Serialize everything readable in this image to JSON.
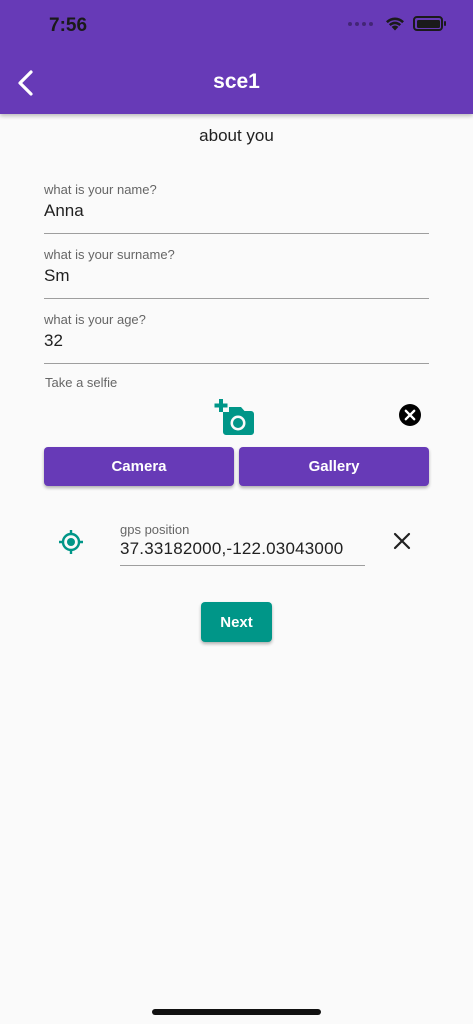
{
  "status_bar": {
    "time": "7:56"
  },
  "app_bar": {
    "title": "sce1",
    "back_icon": "chevron-left-icon"
  },
  "form": {
    "section_title": "about you",
    "name": {
      "label": "what is your name?",
      "value": "Anna"
    },
    "surname": {
      "label": "what is your surname?",
      "value": "Sm"
    },
    "age": {
      "label": "what is your age?",
      "value": "32"
    },
    "selfie": {
      "label": "Take a selfie",
      "add_icon": "add-a-photo-icon",
      "clear_icon": "cancel-circle-icon"
    },
    "camera_label": "Camera",
    "gallery_label": "Gallery",
    "gps": {
      "label": "gps position",
      "value": "37.33182000,-122.03043000",
      "icon": "my-location-icon",
      "clear_icon": "close-icon"
    },
    "next_label": "Next"
  },
  "colors": {
    "primary": "#673ab7",
    "accent": "#009688",
    "background": "#fafafa"
  }
}
